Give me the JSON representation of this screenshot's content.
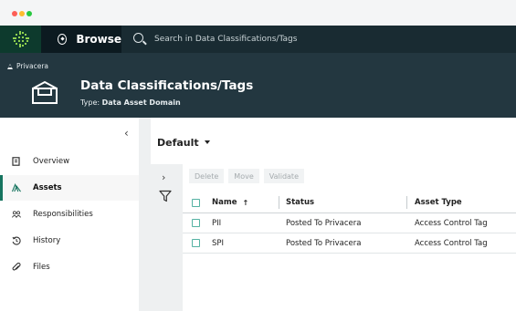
{
  "topbar": {
    "browse_label": "Browse",
    "search_placeholder": "Search in Data Classifications/Tags"
  },
  "header": {
    "breadcrumb": "Privacera",
    "title": "Data Classifications/Tags",
    "type_label": "Type:",
    "type_value": "Data Asset Domain"
  },
  "sidebar": {
    "items": [
      {
        "label": "Overview",
        "icon": "document-icon"
      },
      {
        "label": "Assets",
        "icon": "assets-icon"
      },
      {
        "label": "Responsibilities",
        "icon": "people-icon"
      },
      {
        "label": "History",
        "icon": "history-icon"
      },
      {
        "label": "Files",
        "icon": "paperclip-icon"
      }
    ],
    "active": "Assets"
  },
  "view_selector": "Default",
  "toolbar": {
    "delete_label": "Delete",
    "move_label": "Move",
    "validate_label": "Validate"
  },
  "table": {
    "columns": [
      "Name",
      "Status",
      "Asset Type"
    ],
    "sort_indicator": "↑",
    "rows": [
      {
        "name": "PII",
        "status": "Posted To Privacera",
        "asset_type": "Access Control Tag"
      },
      {
        "name": "SPI",
        "status": "Posted To Privacera",
        "asset_type": "Access Control Tag"
      }
    ]
  },
  "colors": {
    "topbar": "#192b32",
    "header": "#233740",
    "accent": "#16745f",
    "checkbox": "#55b2a3"
  }
}
